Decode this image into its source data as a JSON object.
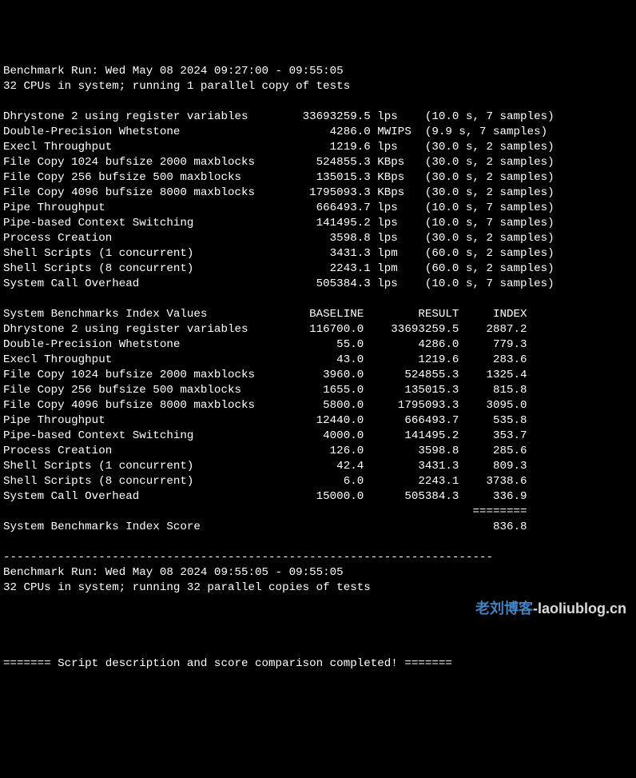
{
  "header": {
    "run_line": "Benchmark Run: Wed May 08 2024 09:27:00 - 09:55:05",
    "cpu_line": "32 CPUs in system; running 1 parallel copy of tests"
  },
  "tests": [
    {
      "name": "Dhrystone 2 using register variables",
      "value": "33693259.5",
      "unit": "lps",
      "timing": "(10.0 s, 7 samples)"
    },
    {
      "name": "Double-Precision Whetstone",
      "value": "4286.0",
      "unit": "MWIPS",
      "timing": "(9.9 s, 7 samples)"
    },
    {
      "name": "Execl Throughput",
      "value": "1219.6",
      "unit": "lps",
      "timing": "(30.0 s, 2 samples)"
    },
    {
      "name": "File Copy 1024 bufsize 2000 maxblocks",
      "value": "524855.3",
      "unit": "KBps",
      "timing": "(30.0 s, 2 samples)"
    },
    {
      "name": "File Copy 256 bufsize 500 maxblocks",
      "value": "135015.3",
      "unit": "KBps",
      "timing": "(30.0 s, 2 samples)"
    },
    {
      "name": "File Copy 4096 bufsize 8000 maxblocks",
      "value": "1795093.3",
      "unit": "KBps",
      "timing": "(30.0 s, 2 samples)"
    },
    {
      "name": "Pipe Throughput",
      "value": "666493.7",
      "unit": "lps",
      "timing": "(10.0 s, 7 samples)"
    },
    {
      "name": "Pipe-based Context Switching",
      "value": "141495.2",
      "unit": "lps",
      "timing": "(10.0 s, 7 samples)"
    },
    {
      "name": "Process Creation",
      "value": "3598.8",
      "unit": "lps",
      "timing": "(30.0 s, 2 samples)"
    },
    {
      "name": "Shell Scripts (1 concurrent)",
      "value": "3431.3",
      "unit": "lpm",
      "timing": "(60.0 s, 2 samples)"
    },
    {
      "name": "Shell Scripts (8 concurrent)",
      "value": "2243.1",
      "unit": "lpm",
      "timing": "(60.0 s, 2 samples)"
    },
    {
      "name": "System Call Overhead",
      "value": "505384.3",
      "unit": "lps",
      "timing": "(10.0 s, 7 samples)"
    }
  ],
  "index_header": {
    "title": "System Benchmarks Index Values",
    "baseline": "BASELINE",
    "result": "RESULT",
    "index": "INDEX"
  },
  "index_rows": [
    {
      "name": "Dhrystone 2 using register variables",
      "baseline": "116700.0",
      "result": "33693259.5",
      "index": "2887.2"
    },
    {
      "name": "Double-Precision Whetstone",
      "baseline": "55.0",
      "result": "4286.0",
      "index": "779.3"
    },
    {
      "name": "Execl Throughput",
      "baseline": "43.0",
      "result": "1219.6",
      "index": "283.6"
    },
    {
      "name": "File Copy 1024 bufsize 2000 maxblocks",
      "baseline": "3960.0",
      "result": "524855.3",
      "index": "1325.4"
    },
    {
      "name": "File Copy 256 bufsize 500 maxblocks",
      "baseline": "1655.0",
      "result": "135015.3",
      "index": "815.8"
    },
    {
      "name": "File Copy 4096 bufsize 8000 maxblocks",
      "baseline": "5800.0",
      "result": "1795093.3",
      "index": "3095.0"
    },
    {
      "name": "Pipe Throughput",
      "baseline": "12440.0",
      "result": "666493.7",
      "index": "535.8"
    },
    {
      "name": "Pipe-based Context Switching",
      "baseline": "4000.0",
      "result": "141495.2",
      "index": "353.7"
    },
    {
      "name": "Process Creation",
      "baseline": "126.0",
      "result": "3598.8",
      "index": "285.6"
    },
    {
      "name": "Shell Scripts (1 concurrent)",
      "baseline": "42.4",
      "result": "3431.3",
      "index": "809.3"
    },
    {
      "name": "Shell Scripts (8 concurrent)",
      "baseline": "6.0",
      "result": "2243.1",
      "index": "3738.6"
    },
    {
      "name": "System Call Overhead",
      "baseline": "15000.0",
      "result": "505384.3",
      "index": "336.9"
    }
  ],
  "score": {
    "separator": "========",
    "label": "System Benchmarks Index Score",
    "value": "836.8"
  },
  "divider": "------------------------------------------------------------------------",
  "run2": {
    "run_line": "Benchmark Run: Wed May 08 2024 09:55:05 - 09:55:05",
    "cpu_line": "32 CPUs in system; running 32 parallel copies of tests"
  },
  "footer": {
    "line": "======= Script description and score comparison completed! ======="
  },
  "watermark": {
    "seg1": "老刘博客",
    "seg2": "-laoliublog.cn"
  }
}
